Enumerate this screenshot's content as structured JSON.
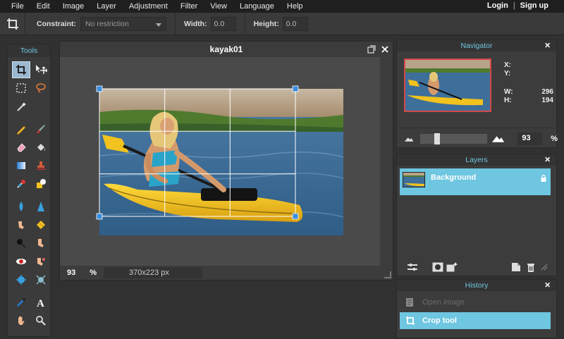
{
  "menu": {
    "items": [
      "File",
      "Edit",
      "Image",
      "Layer",
      "Adjustment",
      "Filter",
      "View",
      "Language",
      "Help"
    ],
    "login": "Login",
    "separator": "|",
    "signup": "Sign up"
  },
  "options": {
    "constraint_label": "Constraint:",
    "constraint_value": "No restriction",
    "width_label": "Width:",
    "width_value": "0.0",
    "height_label": "Height:",
    "height_value": "0.0"
  },
  "tools": {
    "title": "Tools"
  },
  "document": {
    "title": "kayak01",
    "zoom": "93",
    "zoom_unit": "%",
    "size": "370x223 px"
  },
  "navigator": {
    "title": "Navigator",
    "x_label": "X:",
    "y_label": "Y:",
    "w_label": "W:",
    "w_value": "296",
    "h_label": "H:",
    "h_value": "194",
    "zoom": "93",
    "zoom_unit": "%"
  },
  "layers": {
    "title": "Layers",
    "items": [
      {
        "name": "Background"
      }
    ]
  },
  "history": {
    "title": "History",
    "items": [
      {
        "label": "Open image"
      },
      {
        "label": "Crop tool"
      }
    ]
  },
  "colors": {
    "accent": "#6ec6e0",
    "panel_bg": "#3c3c3c",
    "menubar_bg": "#1f1f1f",
    "canvas_bg": "#4a4a4a",
    "kayak": "#f2c21e",
    "water": "#3e6f9a"
  }
}
